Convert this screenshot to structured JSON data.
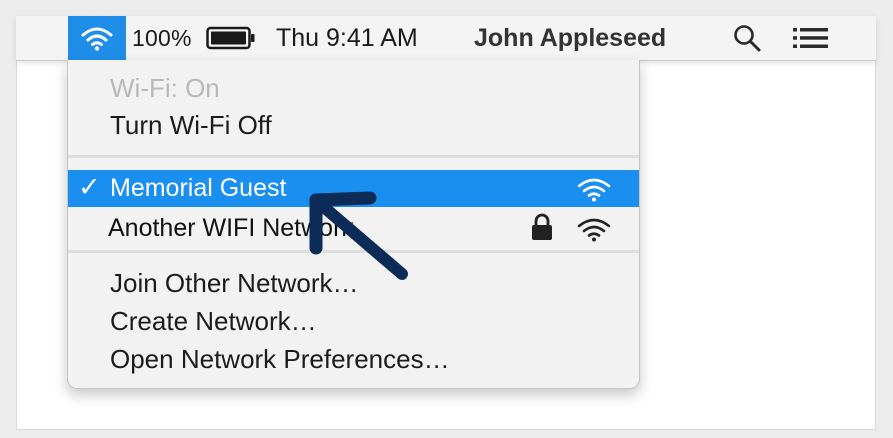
{
  "menubar": {
    "battery_percent": "100%",
    "clock": "Thu 9:41 AM",
    "user_name": "John Appleseed",
    "wifi_icon": "wifi-icon",
    "battery_icon": "battery-icon",
    "search_icon": "search-icon",
    "list_icon": "list-icon",
    "accent_color": "#1f8ee8"
  },
  "wifi_menu": {
    "status": "Wi-Fi: On",
    "toggle_label": "Turn Wi-Fi Off",
    "networks": [
      {
        "name": "Memorial Guest",
        "selected": true,
        "locked": false
      },
      {
        "name": "Another WIFI Network",
        "selected": false,
        "locked": true
      }
    ],
    "actions": [
      "Join Other Network…",
      "Create Network…",
      "Open Network Preferences…"
    ],
    "highlight_color": "#1b8ff0"
  },
  "annotation": {
    "icon": "arrow-pointer-icon",
    "color": "#0d2b57"
  }
}
